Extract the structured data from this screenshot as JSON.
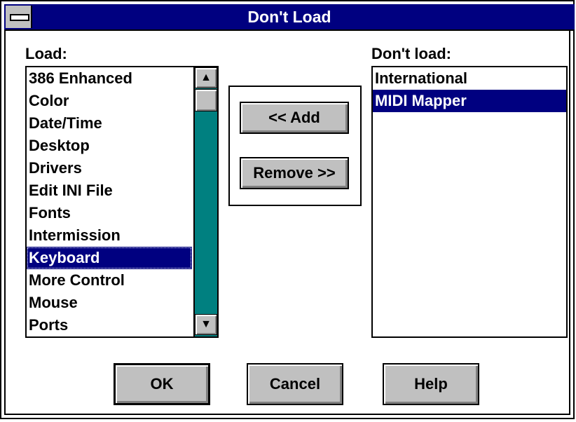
{
  "window": {
    "title": "Don't Load"
  },
  "load": {
    "label": "Load:",
    "items": [
      "386 Enhanced",
      "Color",
      "Date/Time",
      "Desktop",
      "Drivers",
      "Edit INI File",
      "Fonts",
      "Intermission",
      "Keyboard",
      "More Control",
      "Mouse",
      "Ports"
    ],
    "selected": "Keyboard"
  },
  "dontload": {
    "label": "Don't load:",
    "items": [
      "International",
      "MIDI Mapper"
    ],
    "selected": "MIDI Mapper"
  },
  "actions": {
    "add_label": "<< Add",
    "remove_label": "Remove >>"
  },
  "buttons": {
    "ok_label": "OK",
    "cancel_label": "Cancel",
    "help_label": "Help"
  },
  "scroll": {
    "up_icon": "arrow-up-icon",
    "down_icon": "arrow-down-icon"
  },
  "colors": {
    "title_bar": "#000080",
    "selection": "#000080",
    "scroll_track": "#008080",
    "button_face": "#c0c0c0"
  }
}
